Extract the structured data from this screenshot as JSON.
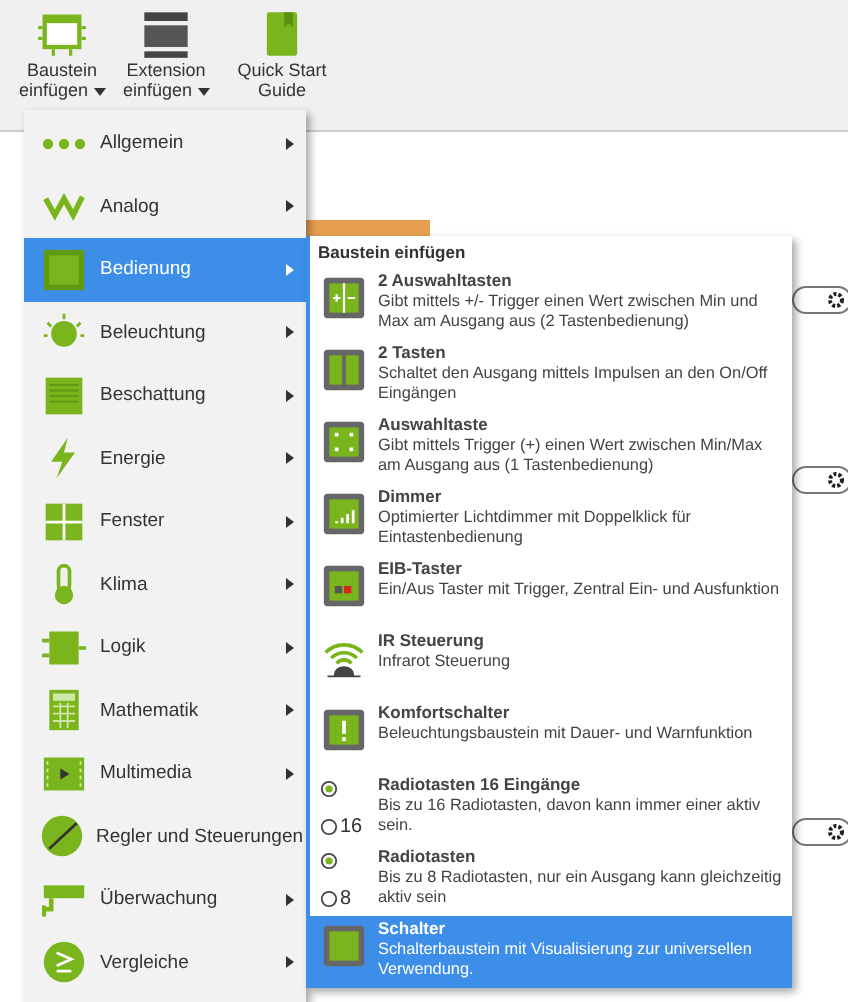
{
  "toolbar": [
    {
      "label": "Baustein einfügen",
      "has_menu": true
    },
    {
      "label": "Extension einfügen",
      "has_menu": true
    },
    {
      "label": "Quick Start Guide",
      "has_menu": false
    }
  ],
  "menu": {
    "items": [
      {
        "label": "Allgemein",
        "selected": false
      },
      {
        "label": "Analog",
        "selected": false
      },
      {
        "label": "Bedienung",
        "selected": true
      },
      {
        "label": "Beleuchtung",
        "selected": false
      },
      {
        "label": "Beschattung",
        "selected": false
      },
      {
        "label": "Energie",
        "selected": false
      },
      {
        "label": "Fenster",
        "selected": false
      },
      {
        "label": "Klima",
        "selected": false
      },
      {
        "label": "Logik",
        "selected": false
      },
      {
        "label": "Mathematik",
        "selected": false
      },
      {
        "label": "Multimedia",
        "selected": false
      },
      {
        "label": "Regler und Steuerungen",
        "selected": false
      },
      {
        "label": "Überwachung",
        "selected": false
      },
      {
        "label": "Vergleiche",
        "selected": false
      }
    ]
  },
  "submenu": {
    "header": "Baustein einfügen",
    "items": [
      {
        "title": "2 Auswahltasten",
        "description": "Gibt mittels +/- Trigger einen Wert zwischen Min und Max am Ausgang aus (2 Tastenbedienung)",
        "selected": false
      },
      {
        "title": "2 Tasten",
        "description": "Schaltet den Ausgang mittels Impulsen an den On/Off Eingängen",
        "selected": false
      },
      {
        "title": "Auswahltaste",
        "description": "Gibt mittels Trigger (+) einen Wert zwischen Min/Max am Ausgang aus (1 Tastenbedienung)",
        "selected": false
      },
      {
        "title": "Dimmer",
        "description": "Optimierter Lichtdimmer mit Doppelklick für Eintastenbedienung",
        "selected": false
      },
      {
        "title": "EIB-Taster",
        "description": "Ein/Aus Taster mit Trigger, Zentral Ein- und Ausfunktion",
        "selected": false
      },
      {
        "title": "IR Steuerung",
        "description": "Infrarot Steuerung",
        "selected": false
      },
      {
        "title": "Komfortschalter",
        "description": "Beleuchtungsbaustein mit Dauer- und Warnfunktion",
        "selected": false
      },
      {
        "title": "Radiotasten 16 Eingänge",
        "description": "Bis zu 16 Radiotasten, davon kann immer einer aktiv sein.",
        "icon_number": "16",
        "selected": false
      },
      {
        "title": "Radiotasten",
        "description": "Bis zu 8 Radiotasten, nur ein Ausgang kann gleichzeitig aktiv sein",
        "icon_number": "8",
        "selected": false
      },
      {
        "title": "Schalter",
        "description": "Schalterbaustein mit Visualisierung zur universellen Verwendung.",
        "selected": true
      }
    ]
  }
}
